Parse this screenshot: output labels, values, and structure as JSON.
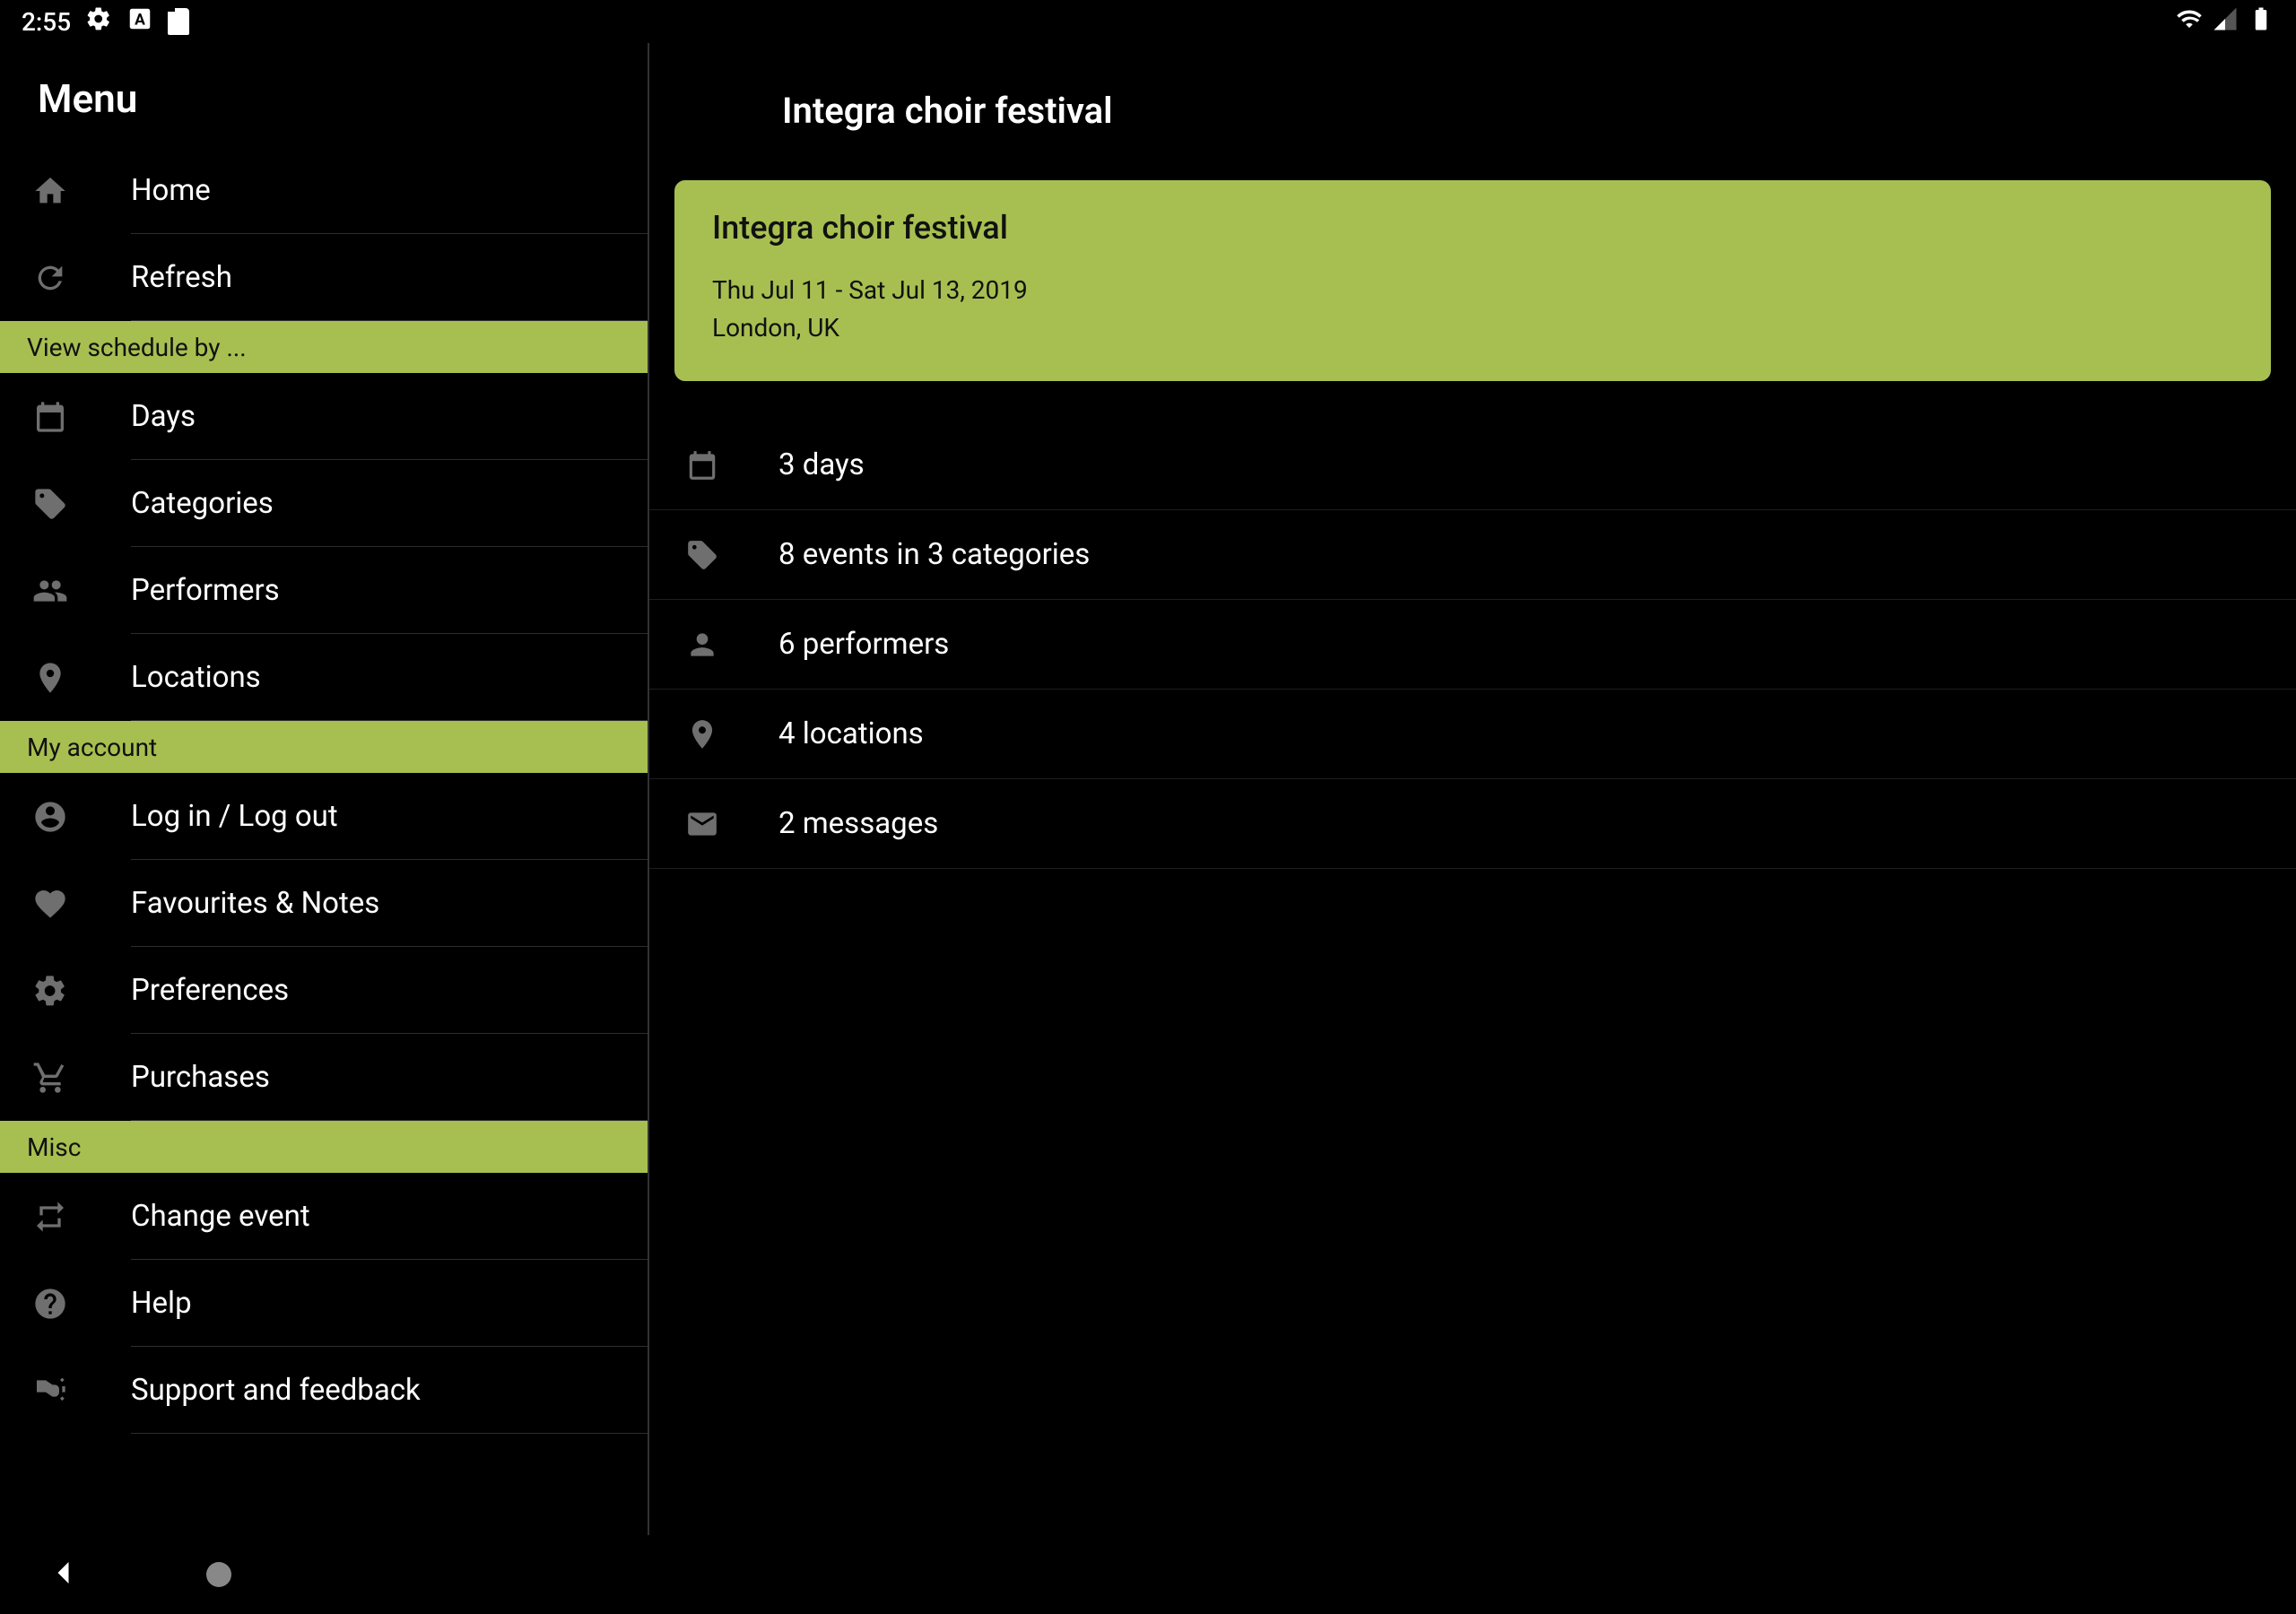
{
  "status_bar": {
    "time": "2:55"
  },
  "sidebar": {
    "title": "Menu",
    "items_top": [
      {
        "icon": "home",
        "label": "Home"
      },
      {
        "icon": "refresh",
        "label": "Refresh"
      }
    ],
    "section_schedule": "View schedule by ...",
    "items_schedule": [
      {
        "icon": "calendar",
        "label": "Days"
      },
      {
        "icon": "tag",
        "label": "Categories"
      },
      {
        "icon": "people",
        "label": "Performers"
      },
      {
        "icon": "location",
        "label": "Locations"
      }
    ],
    "section_account": "My account",
    "items_account": [
      {
        "icon": "account",
        "label": "Log in / Log out"
      },
      {
        "icon": "heart",
        "label": "Favourites & Notes"
      },
      {
        "icon": "gear",
        "label": "Preferences"
      },
      {
        "icon": "cart",
        "label": "Purchases"
      }
    ],
    "section_misc": "Misc",
    "items_misc": [
      {
        "icon": "swap",
        "label": "Change event"
      },
      {
        "icon": "help",
        "label": "Help"
      },
      {
        "icon": "megaphone",
        "label": "Support and feedback"
      }
    ]
  },
  "content": {
    "title": "Integra choir festival",
    "event": {
      "name": "Integra choir festival",
      "dates": "Thu Jul 11 - Sat Jul 13, 2019",
      "location": "London, UK"
    },
    "stats": [
      {
        "icon": "calendar",
        "label": "3 days"
      },
      {
        "icon": "tag",
        "label": "8 events in 3 categories"
      },
      {
        "icon": "person",
        "label": "6 performers"
      },
      {
        "icon": "location",
        "label": "4 locations"
      },
      {
        "icon": "mail",
        "label": "2 messages"
      }
    ]
  }
}
